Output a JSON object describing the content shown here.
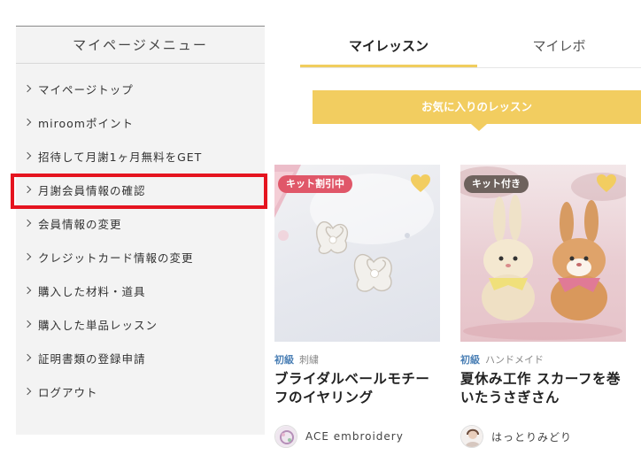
{
  "sidebar": {
    "title": "マイページメニュー",
    "items": [
      {
        "label": "マイページトップ"
      },
      {
        "label": "miroomポイント"
      },
      {
        "label": "招待して月謝1ヶ月無料をGET"
      },
      {
        "label": "月謝会員情報の確認"
      },
      {
        "label": "会員情報の変更"
      },
      {
        "label": "クレジットカード情報の変更"
      },
      {
        "label": "購入した材料・道具"
      },
      {
        "label": "購入した単品レッスン"
      },
      {
        "label": "証明書類の登録申請"
      },
      {
        "label": "ログアウト"
      }
    ],
    "highlight_color": "#e5141f"
  },
  "tabs": [
    {
      "label": "マイレッスン",
      "active": true
    },
    {
      "label": "マイレボ",
      "active": false
    }
  ],
  "section": {
    "title": "お気に入りのレッスン",
    "color": "#f2cd60"
  },
  "lessons": [
    {
      "badge": "キット割引中",
      "level": "初級",
      "category": "刺繍",
      "title": "ブライダルベールモチーフのイヤリング",
      "author": "ACE embroidery",
      "favorite_icon": "heart-icon"
    },
    {
      "badge": "キット付き",
      "level": "初級",
      "category": "ハンドメイド",
      "title": "夏休み工作 スカーフを巻いたうさぎさん",
      "author": "はっとりみどり",
      "favorite_icon": "heart-icon"
    }
  ]
}
